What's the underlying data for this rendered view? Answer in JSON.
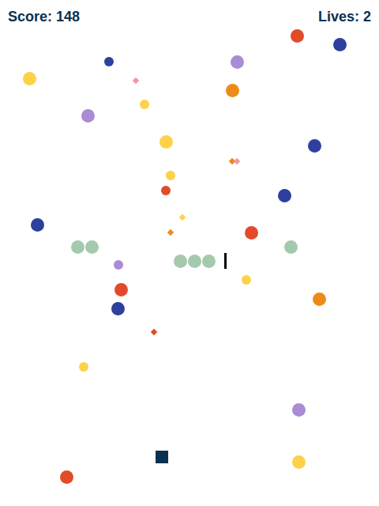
{
  "hud": {
    "score": "Score: 148",
    "lives": "Lives: 2"
  },
  "objects": [
    {
      "kind": "ball",
      "color": "#e34a2a"
    },
    {
      "kind": "ball",
      "color": "#2e3f9e"
    },
    {
      "kind": "ball",
      "color": "#a98bd6"
    },
    {
      "kind": "ball",
      "color": "#ee8a1a"
    },
    {
      "kind": "ball",
      "color": "#fdd14a"
    },
    {
      "kind": "ball",
      "color": "#a98bd6"
    },
    {
      "kind": "ball",
      "color": "#fdd14a"
    },
    {
      "kind": "ball",
      "color": "#2e3f9e"
    },
    {
      "kind": "ball",
      "color": "#2e3f9e"
    },
    {
      "kind": "ball",
      "color": "#2e3f9e"
    },
    {
      "kind": "ball",
      "color": "#e34a2a"
    },
    {
      "kind": "ball",
      "color": "#a5c9ac"
    },
    {
      "kind": "ball",
      "color": "#a5c9ac"
    },
    {
      "kind": "ball",
      "color": "#a5c9ac"
    },
    {
      "kind": "ball",
      "color": "#a5c9ac"
    },
    {
      "kind": "ball",
      "color": "#a5c9ac"
    },
    {
      "kind": "ball",
      "color": "#a5c9ac"
    },
    {
      "kind": "ball",
      "color": "#e34a2a"
    },
    {
      "kind": "ball",
      "color": "#2e3f9e"
    },
    {
      "kind": "ball",
      "color": "#ee8a1a"
    },
    {
      "kind": "ball",
      "color": "#a98bd6"
    },
    {
      "kind": "ball",
      "color": "#fdd14a"
    },
    {
      "kind": "ball",
      "color": "#e34a2a"
    },
    {
      "kind": "small",
      "color": "#2e3f9e"
    },
    {
      "kind": "small",
      "color": "#fdd14a"
    },
    {
      "kind": "small",
      "color": "#fdd14a"
    },
    {
      "kind": "small",
      "color": "#e34a2a"
    },
    {
      "kind": "small",
      "color": "#a98bd6"
    },
    {
      "kind": "small",
      "color": "#fdd14a"
    },
    {
      "kind": "small",
      "color": "#fdd14a"
    },
    {
      "kind": "spark",
      "color": "#eb9aa5"
    },
    {
      "kind": "spark",
      "color": "#ee8a1a"
    },
    {
      "kind": "spark",
      "color": "#eb9aa5"
    },
    {
      "kind": "spark",
      "color": "#fdd14a"
    },
    {
      "kind": "spark",
      "color": "#ee8a1a"
    },
    {
      "kind": "spark",
      "color": "#e34a2a"
    }
  ]
}
